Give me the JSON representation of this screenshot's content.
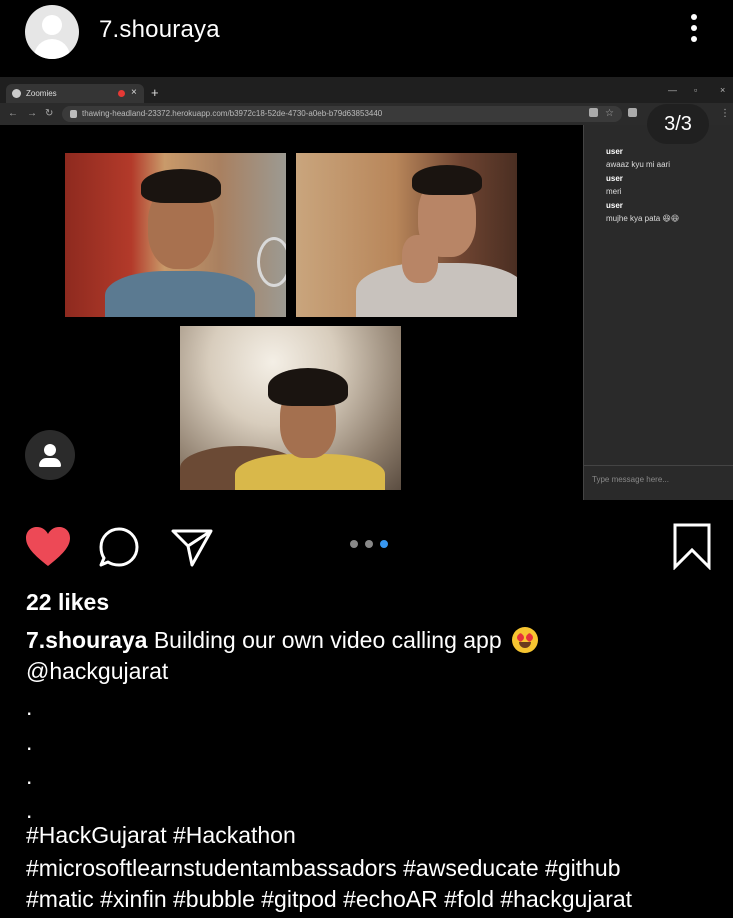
{
  "header": {
    "username": "7.shouraya"
  },
  "media": {
    "browser": {
      "tab_title": "Zoomies",
      "url": "thawing-headland-23372.herokuapp.com/b3972c18-52de-4730-a0eb-b79d63853440"
    },
    "counter": "3/3",
    "chat": {
      "messages": [
        {
          "user": "user",
          "text": "awaaz kyu mi aari"
        },
        {
          "user": "user",
          "text": "meri"
        },
        {
          "user": "user",
          "text": "mujhe kya pata 😆😆"
        }
      ],
      "input_placeholder": "Type message here..."
    },
    "carousel": {
      "count": 3,
      "active": 3
    }
  },
  "post": {
    "likes": "22 likes",
    "caption_user": "7.shouraya",
    "caption_text": "Building our own video calling app",
    "mention": "@hackgujarat",
    "periods": [
      ".",
      ".",
      ".",
      "."
    ],
    "hashtags": [
      "#HackGujarat #Hackathon",
      "#microsoftlearnstudentambassadors #awseducate #github",
      "#matic #xinfin #bubble #gitpod #echoAR #fold #hackgujarat"
    ]
  },
  "colors": {
    "like": "#ed4956",
    "carousel_active": "#3897f0"
  }
}
